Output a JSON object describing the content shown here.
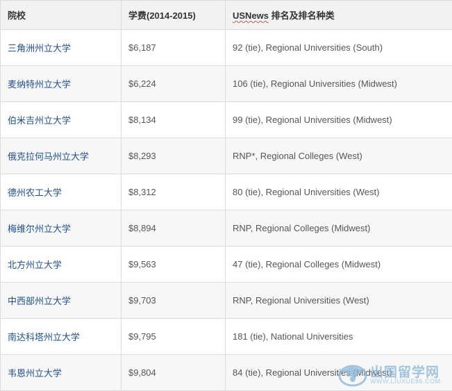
{
  "table": {
    "headers": {
      "school": "院校",
      "tuition": "学费(2014-2015)",
      "ranking_prefix": "USNews",
      "ranking_suffix": " 排名及排名种类"
    },
    "rows": [
      {
        "school": "三角洲州立大学",
        "tuition": "$6,187",
        "ranking": "92 (tie), Regional Universities (South)"
      },
      {
        "school": "麦纳特州立大学",
        "tuition": "$6,224",
        "ranking": "106 (tie), Regional Universities (Midwest)"
      },
      {
        "school": "伯米吉州立大学",
        "tuition": "$8,134",
        "ranking": "99 (tie), Regional Universities (Midwest)"
      },
      {
        "school": "俄克拉何马州立大学",
        "tuition": "$8,293",
        "ranking": "RNP*, Regional Colleges (West)"
      },
      {
        "school": "德州农工大学",
        "tuition": "$8,312",
        "ranking": "80 (tie), Regional Universities (West)"
      },
      {
        "school": "梅维尔州立大学",
        "tuition": "$8,894",
        "ranking": "RNP, Regional Colleges (Midwest)"
      },
      {
        "school": "北方州立大学",
        "tuition": "$9,563",
        "ranking": "47 (tie), Regional Colleges (Midwest)"
      },
      {
        "school": "中西部州立大学",
        "tuition": "$9,703",
        "ranking": "RNP, Regional Universities (West)"
      },
      {
        "school": "南达科塔州立大学",
        "tuition": "$9,795",
        "ranking": "181 (tie), National Universities"
      },
      {
        "school": "韦恩州立大学",
        "tuition": "$9,804",
        "ranking": "84 (tie), Regional Universities (Midwest)"
      }
    ]
  },
  "watermark": {
    "text": "出国留学网",
    "url": "WWW.LIUXUE86.COM"
  }
}
